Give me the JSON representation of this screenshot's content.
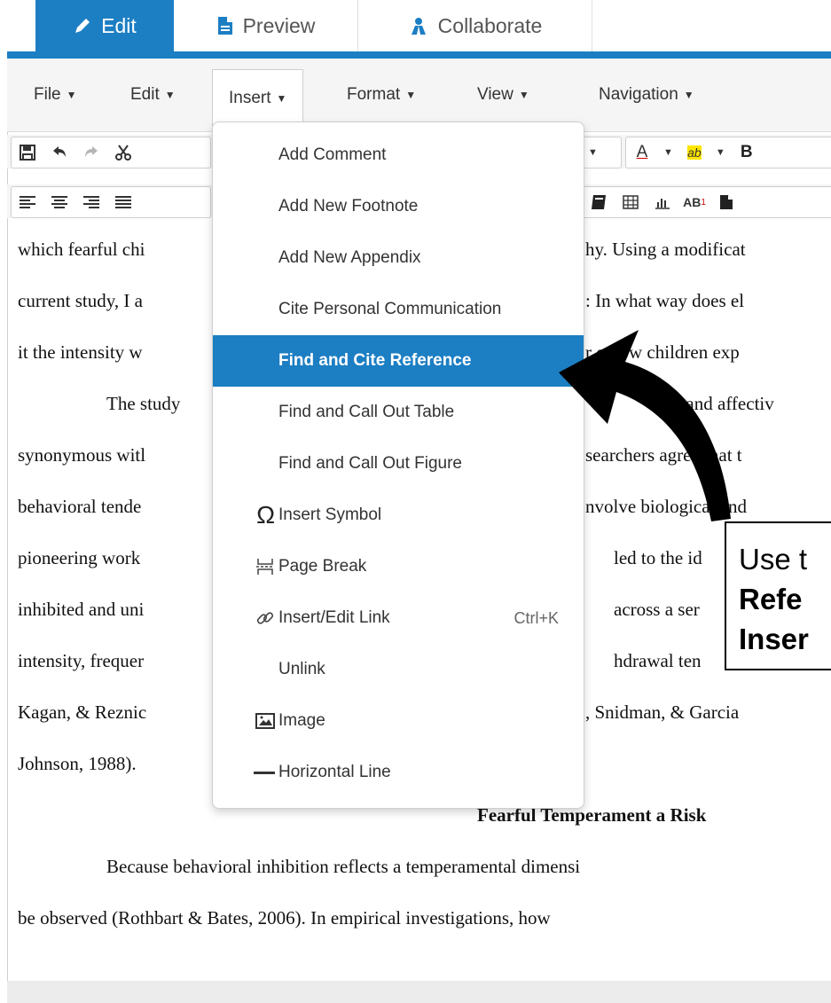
{
  "tabs": [
    {
      "label": "Edit",
      "active": true,
      "icon": "pencil-icon"
    },
    {
      "label": "Preview",
      "active": false,
      "icon": "document-icon"
    },
    {
      "label": "Collaborate",
      "active": false,
      "icon": "people-icon"
    }
  ],
  "menubar": {
    "items": [
      "File",
      "Edit",
      "Insert",
      "Format",
      "View",
      "Navigation"
    ],
    "open": "Insert"
  },
  "toolbar": {
    "row1_icons": [
      "save-icon",
      "undo-icon",
      "redo-icon",
      "cut-icon"
    ],
    "font_color_label": "A",
    "highlight_label": "ab",
    "bold_label": "B",
    "row2_icons": [
      "align-left-icon",
      "align-center-icon",
      "align-right-icon",
      "align-justify-icon"
    ],
    "row2_right_icons": [
      "book-icon",
      "table-icon",
      "chart-icon",
      "superscript-icon",
      "page-icon"
    ],
    "superscript_label": "AB"
  },
  "document": {
    "lines": [
      "which fearful chi",
      "current study, I a",
      "it the intensity w",
      "The study",
      "synonymous witl",
      "behavioral tende",
      "pioneering work",
      "inhibited and uni",
      "intensity, frequer",
      "Kagan, & Reznic",
      "Johnson, 1988)."
    ],
    "right_fragments": [
      "hy. Using a modificat",
      ": In what way does el",
      "r o how children exp",
      "s and affectiv",
      "searchers agree that t",
      "nvolve biological and",
      "led to the id",
      "across a ser",
      "hdrawal ten",
      ", Snidman, & Garcia",
      ""
    ],
    "heading": "Fearful Temperament a Risk",
    "after_heading": [
      "Because behavioral inhibition reflects a temperamental dimensi",
      "be observed (Rothbart & Bates, 2006). In empirical investigations, how"
    ]
  },
  "insert_menu": {
    "items": [
      {
        "label": "Add Comment",
        "icon": ""
      },
      {
        "label": "Add New Footnote",
        "icon": ""
      },
      {
        "label": "Add New Appendix",
        "icon": ""
      },
      {
        "label": "Cite Personal Communication",
        "icon": ""
      },
      {
        "label": "Find and Cite Reference",
        "icon": "",
        "selected": true
      },
      {
        "label": "Find and Call Out Table",
        "icon": ""
      },
      {
        "label": "Find and Call Out Figure",
        "icon": ""
      },
      {
        "label": "Insert Symbol",
        "icon": "omega-icon"
      },
      {
        "label": "Page Break",
        "icon": "page-break-icon"
      },
      {
        "label": "Insert/Edit Link",
        "icon": "link-icon",
        "shortcut": "Ctrl+K"
      },
      {
        "label": "Unlink",
        "icon": ""
      },
      {
        "label": "Image",
        "icon": "image-icon"
      },
      {
        "label": "Horizontal Line",
        "icon": "horizontal-line-icon"
      }
    ]
  },
  "callout": {
    "line1": "Use t",
    "line2": "Refe",
    "line3": "Inser"
  },
  "colors": {
    "accent": "#1c7ec3",
    "menubar_bg": "#f5f5f5",
    "callout_border": "#000000"
  }
}
